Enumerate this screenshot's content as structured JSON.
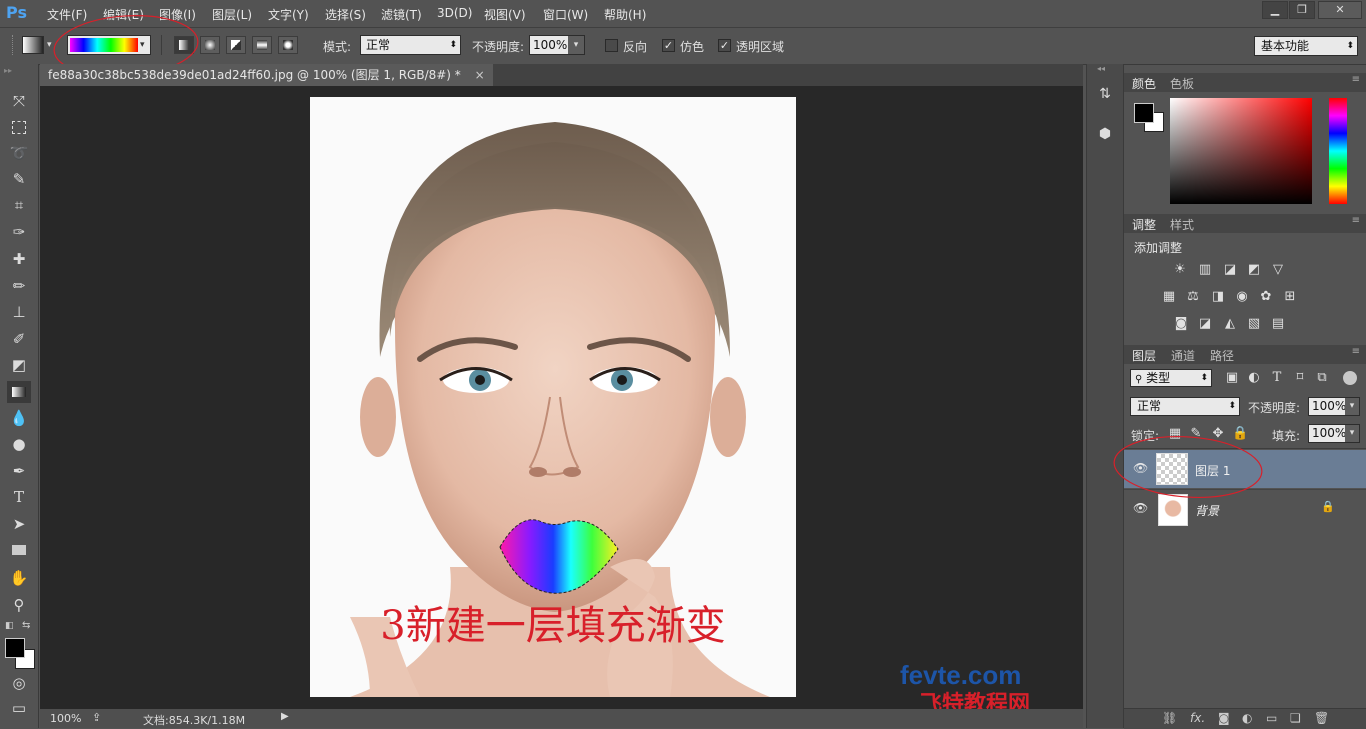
{
  "app": {
    "logo": "Ps"
  },
  "menu": [
    "文件(F)",
    "编辑(E)",
    "图像(I)",
    "图层(L)",
    "文字(Y)",
    "选择(S)",
    "滤镜(T)",
    "3D(D)",
    "视图(V)",
    "窗口(W)",
    "帮助(H)"
  ],
  "window_controls": {
    "minimize": "▁",
    "restore": "❐",
    "close": "✕"
  },
  "options": {
    "mode_label": "模式:",
    "mode_value": "正常",
    "opacity_label": "不透明度:",
    "opacity_value": "100%",
    "reverse_label": "反向",
    "dither_label": "仿色",
    "transparency_label": "透明区域",
    "workspace_value": "基本功能",
    "reverse_checked": false,
    "dither_checked": true,
    "transparency_checked": true
  },
  "document": {
    "tab_title": "fe88a30c38bc538de39de01ad24ff60.jpg @ 100% (图层 1, RGB/8#) *",
    "tab_close": "×",
    "annotation_text": "3新建一层填充渐变",
    "watermark_line1": "fevte.com",
    "watermark_line2": "飞特教程网"
  },
  "status": {
    "zoom": "100%",
    "doc_info": "文档:854.3K/1.18M"
  },
  "color_panel": {
    "tab1": "颜色",
    "tab2": "色板"
  },
  "adjust_panel": {
    "tab1": "调整",
    "tab2": "样式",
    "title": "添加调整"
  },
  "layers_panel": {
    "tab1": "图层",
    "tab2": "通道",
    "tab3": "路径",
    "filter_value": "类型",
    "blend_value": "正常",
    "opacity_label": "不透明度:",
    "opacity_value": "100%",
    "lock_label": "锁定:",
    "fill_label": "填充:",
    "fill_value": "100%",
    "layers": [
      {
        "name": "图层 1",
        "selected": true
      },
      {
        "name": "背景",
        "selected": false
      }
    ],
    "footer_icons": [
      "link-icon",
      "fx-icon",
      "mask-icon",
      "adjustment-icon",
      "folder-icon",
      "new-layer-icon",
      "trash-icon"
    ],
    "footer_fx": "fx."
  },
  "colors": {
    "accent": "#4ea3f1",
    "annotation_red": "#d8202a",
    "selected_layer": "#6a7d95"
  }
}
